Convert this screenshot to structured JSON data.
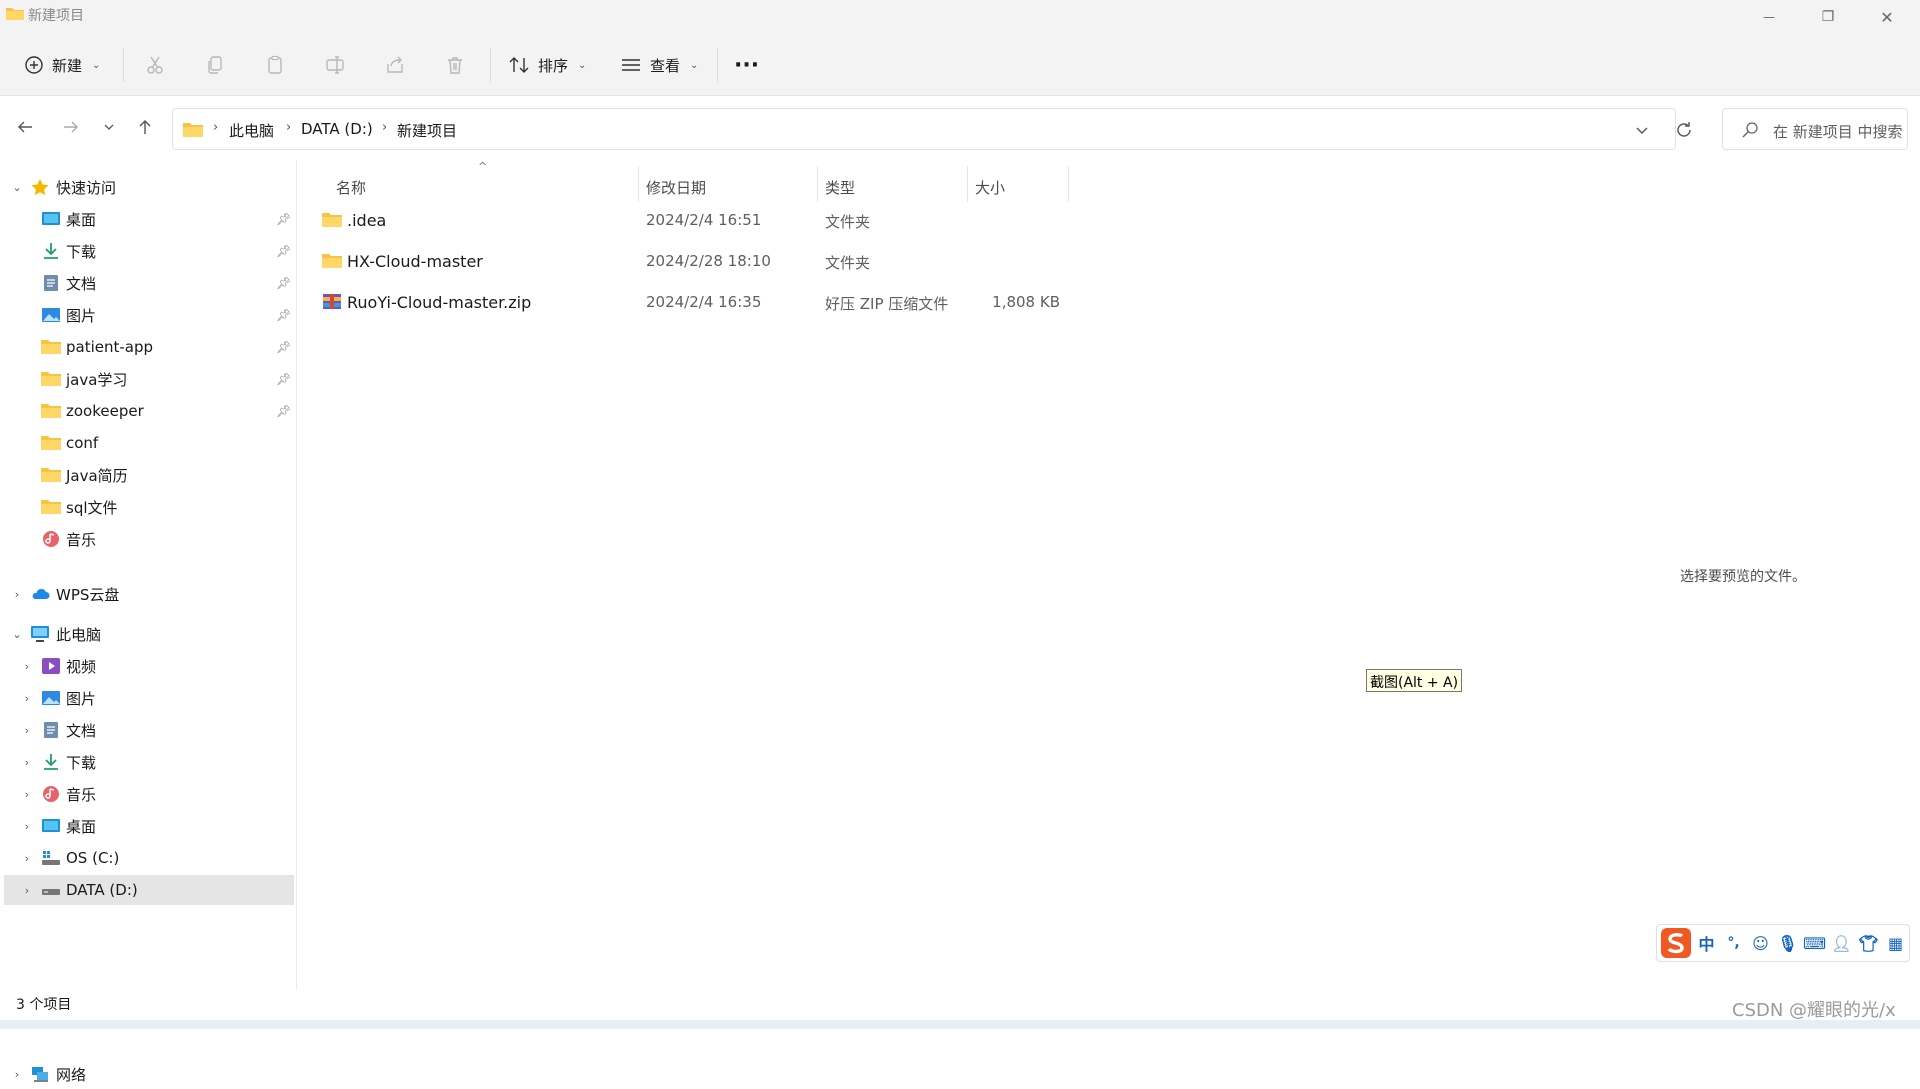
{
  "window": {
    "title": "新建项目",
    "minimize_glyph": "—",
    "maximize_glyph": "❐",
    "close_glyph": "✕"
  },
  "toolbar": {
    "new_label": "新建",
    "sort_label": "排序",
    "view_label": "查看",
    "more_label": "···",
    "disabled_icons": [
      "cut-icon",
      "copy-icon",
      "paste-icon",
      "rename-icon",
      "share-icon",
      "delete-icon"
    ]
  },
  "address": {
    "crumbs": [
      "此电脑",
      "DATA (D:)",
      "新建项目"
    ],
    "search_placeholder": "在 新建项目 中搜索"
  },
  "nav": {
    "quick_access": {
      "label": "快速访问",
      "items": [
        {
          "label": "桌面",
          "icon": "desktop-icon",
          "pinned": true
        },
        {
          "label": "下载",
          "icon": "download-icon",
          "pinned": true
        },
        {
          "label": "文档",
          "icon": "document-icon",
          "pinned": true
        },
        {
          "label": "图片",
          "icon": "pictures-icon",
          "pinned": true
        },
        {
          "label": "patient-app",
          "icon": "folder-icon",
          "pinned": true
        },
        {
          "label": "java学习",
          "icon": "folder-icon",
          "pinned": true
        },
        {
          "label": "zookeeper",
          "icon": "folder-icon",
          "pinned": true
        },
        {
          "label": "conf",
          "icon": "folder-icon",
          "pinned": false
        },
        {
          "label": "Java简历",
          "icon": "folder-icon",
          "pinned": false
        },
        {
          "label": "sql文件",
          "icon": "folder-icon",
          "pinned": false
        },
        {
          "label": "音乐",
          "icon": "music-icon",
          "pinned": false
        }
      ]
    },
    "wps": {
      "label": "WPS云盘"
    },
    "this_pc": {
      "label": "此电脑",
      "items": [
        {
          "label": "视频",
          "icon": "videos-icon"
        },
        {
          "label": "图片",
          "icon": "pictures-icon"
        },
        {
          "label": "文档",
          "icon": "document-icon"
        },
        {
          "label": "下载",
          "icon": "download-icon"
        },
        {
          "label": "音乐",
          "icon": "music-icon"
        },
        {
          "label": "桌面",
          "icon": "desktop-icon"
        },
        {
          "label": "OS (C:)",
          "icon": "os-drive-icon"
        },
        {
          "label": "DATA (D:)",
          "icon": "drive-icon",
          "selected": true
        }
      ]
    },
    "network": {
      "label": "网络"
    }
  },
  "columns": {
    "name": "名称",
    "modified": "修改日期",
    "type": "类型",
    "size": "大小",
    "sort_glyph": "^"
  },
  "files": [
    {
      "name": ".idea",
      "modified": "2024/2/4 16:51",
      "type": "文件夹",
      "size": "",
      "icon": "folder-icon"
    },
    {
      "name": "HX-Cloud-master",
      "modified": "2024/2/28 18:10",
      "type": "文件夹",
      "size": "",
      "icon": "folder-icon"
    },
    {
      "name": "RuoYi-Cloud-master.zip",
      "modified": "2024/2/4 16:35",
      "type": "好压 ZIP 压缩文件",
      "size": "1,808 KB",
      "icon": "zip-archive-icon"
    }
  ],
  "preview": {
    "message": "选择要预览的文件。"
  },
  "tooltip": {
    "text": "截图(Alt + A)"
  },
  "status": {
    "item_count": "3 个项目"
  },
  "ime": {
    "mode": "中",
    "punct": "°,"
  },
  "watermark": {
    "text": "CSDN @耀眼的光/x"
  }
}
